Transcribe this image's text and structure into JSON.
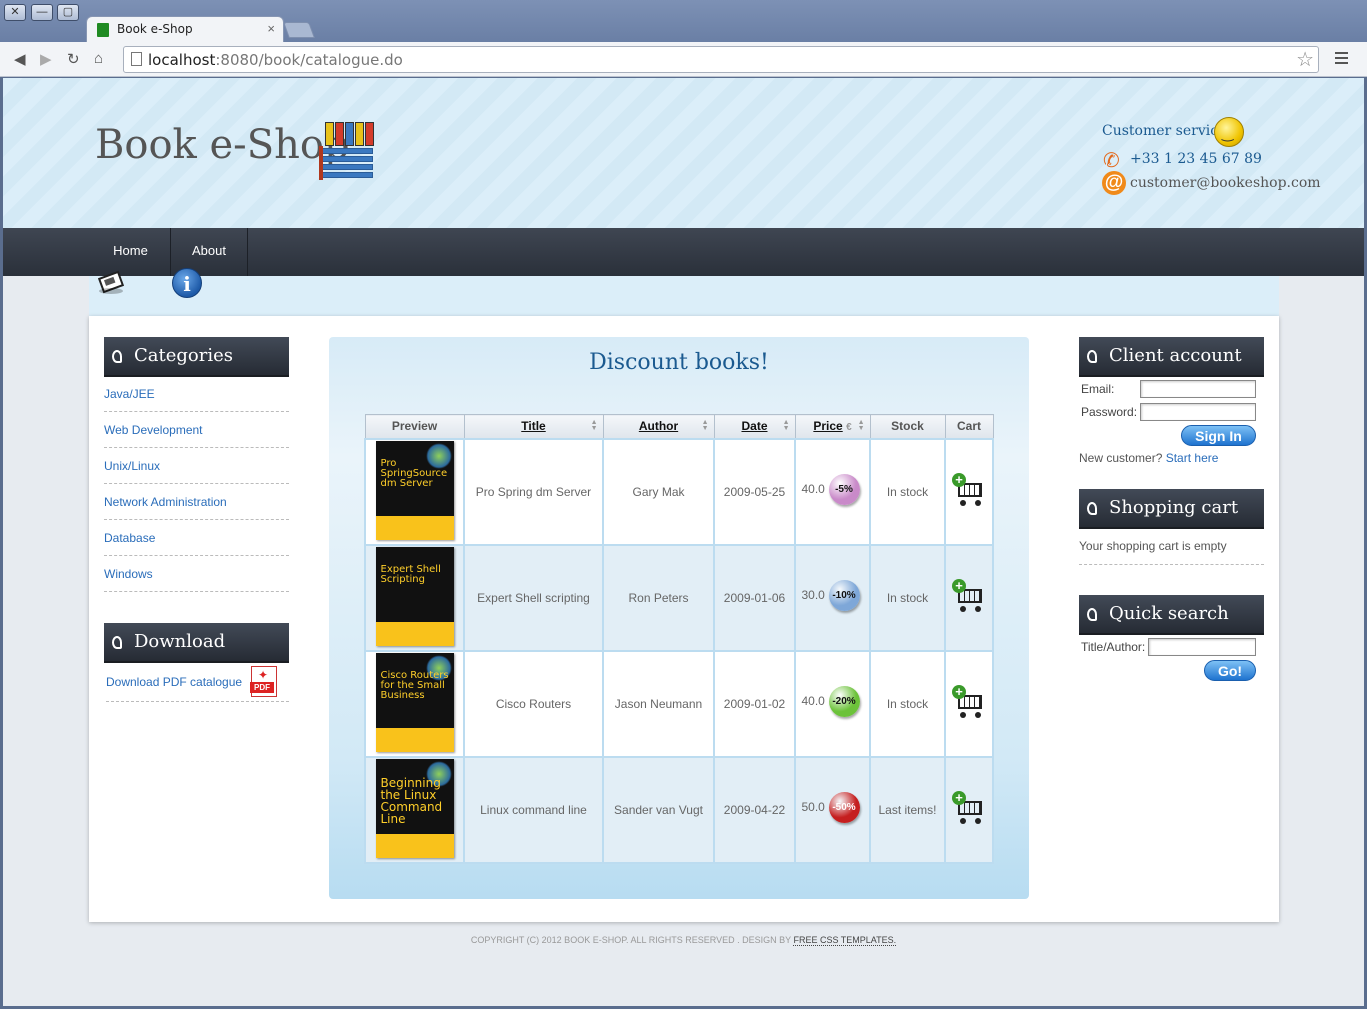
{
  "browser": {
    "tab_title": "Book e-Shop",
    "url_host": "localhost",
    "url_rest": ":8080/book/catalogue.do"
  },
  "header": {
    "logo_text": "Book e-Shop",
    "customer_service_label": "Customer service",
    "phone": "+33 1 23 45 67 89",
    "email": "customer@bookeshop.com"
  },
  "nav": {
    "items": [
      {
        "label": "Home",
        "icon": "home-icon"
      },
      {
        "label": "About",
        "icon": "info-icon"
      }
    ]
  },
  "sidebar_left": {
    "categories_title": "Categories",
    "categories": [
      "Java/JEE",
      "Web Development",
      "Unix/Linux",
      "Network Administration",
      "Database",
      "Windows"
    ],
    "download_title": "Download",
    "download_link": "Download PDF catalogue",
    "pdf_label": "PDF"
  },
  "main": {
    "title": "Discount books!",
    "columns": [
      "Preview",
      "Title",
      "Author",
      "Date",
      "Price",
      "Stock",
      "Cart"
    ],
    "books": [
      {
        "cover_title": "Pro SpringSource dm Server",
        "title": "Pro Spring dm Server",
        "author": "Gary Mak",
        "date": "2009-05-25",
        "price": "40.0",
        "discount": "-5%",
        "discount_color": "#c98ac9",
        "stock": "In stock"
      },
      {
        "cover_title": "Expert Shell Scripting",
        "title": "Expert Shell scripting",
        "author": "Ron Peters",
        "date": "2009-01-06",
        "price": "30.0",
        "discount": "-10%",
        "discount_color": "#7ea7d8",
        "stock": "In stock"
      },
      {
        "cover_title": "Cisco Routers for the Small Business",
        "title": "Cisco Routers",
        "author": "Jason Neumann",
        "date": "2009-01-02",
        "price": "40.0",
        "discount": "-20%",
        "discount_color": "#6cc23a",
        "stock": "In stock"
      },
      {
        "cover_title": "Beginning the Linux Command Line",
        "title": "Linux command line",
        "author": "Sander van Vugt",
        "date": "2009-04-22",
        "price": "50.0",
        "discount": "-50%",
        "discount_color": "#c51f1f",
        "stock": "Last items!"
      }
    ]
  },
  "sidebar_right": {
    "account_title": "Client account",
    "email_label": "Email:",
    "password_label": "Password:",
    "sign_in": "Sign In",
    "new_customer": "New customer?",
    "start_here": "Start here",
    "cart_title": "Shopping cart",
    "cart_empty": "Your shopping cart is empty",
    "search_title": "Quick search",
    "search_label": "Title/Author:",
    "go": "Go!"
  },
  "footer": {
    "copyright": "COPYRIGHT (C) 2012 BOOK E-SHOP. ALL RIGHTS RESERVED . DESIGN BY",
    "link": "FREE CSS TEMPLATES."
  }
}
